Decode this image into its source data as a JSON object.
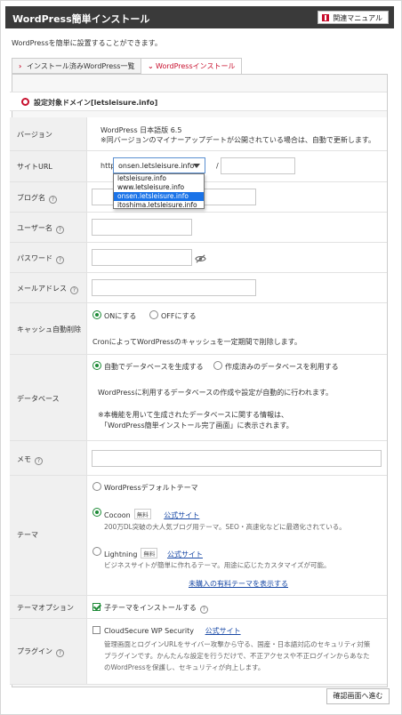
{
  "header": {
    "title": "WordPress簡単インストール",
    "manual_button": "関連マニュアル"
  },
  "intro": "WordPressを簡単に設置することができます。",
  "tabs": [
    {
      "label": "インストール済みWordPress一覧",
      "marker": "›",
      "active": false
    },
    {
      "label": "WordPressインストール",
      "marker": "⌄",
      "active": true
    }
  ],
  "domain": {
    "label": "設定対象ドメイン[letsleisure.info]"
  },
  "fields": {
    "version": {
      "label": "バージョン",
      "line1": "WordPress 日本語版 6.5",
      "line2": "※同バージョンのマイナーアップデートが公開されている場合は、自動で更新します。"
    },
    "site_url": {
      "label": "サイトURL",
      "prefix": "http://",
      "selected": "onsen.letsleisure.info",
      "slash": "/",
      "options": [
        "letsleisure.info",
        "www.letsleisure.info",
        "onsen.letsleisure.info",
        "itoshima.letsleisure.info"
      ],
      "selected_index": 2
    },
    "blog_name": {
      "label": "ブログ名"
    },
    "user_name": {
      "label": "ユーザー名"
    },
    "password": {
      "label": "パスワード"
    },
    "email": {
      "label": "メールアドレス"
    },
    "cache": {
      "label": "キャッシュ自動削除",
      "on_label": "ONにする",
      "off_label": "OFFにする",
      "note": "CronによってWordPressのキャッシュを一定期間で削除します。"
    },
    "database": {
      "label": "データベース",
      "opt_auto": "自動でデータベースを生成する",
      "opt_existing": "作成済みのデータベースを利用する",
      "note1": "WordPressに利用するデータベースの作成や設定が自動的に行われます。",
      "note2": "※本機能を用いて生成されたデータベースに関する情報は、",
      "note3": "「WordPress簡単インストール完了画面」に表示されます。"
    },
    "memo": {
      "label": "メモ"
    },
    "theme": {
      "label": "テーマ",
      "default_theme": "WordPressデフォルトテーマ",
      "cocoon": "Cocoon",
      "cocoon_badge": "無料",
      "cocoon_link": "公式サイト",
      "cocoon_desc": "200万DL突破の大人気ブログ用テーマ。SEO・高速化などに最適化されている。",
      "lightning": "Lightning",
      "lightning_badge": "無料",
      "lightning_link": "公式サイト",
      "lightning_desc": "ビジネスサイトが簡単に作れるテーマ。用途に応じたカスタマイズが可能。",
      "paid_link": "未購入の有料テーマを表示する"
    },
    "theme_option": {
      "label": "テーマオプション",
      "child": "子テーマをインストールする"
    },
    "plugin": {
      "label": "プラグイン",
      "name": "CloudSecure WP Security",
      "link": "公式サイト",
      "desc1": "管理画面とログインURLをサイバー攻撃から守る、国産・日本語対応のセキュリティ対策",
      "desc2": "プラグインです。かんたんな設定を行うだけで、不正アクセスや不正ログインからあなた",
      "desc3": "のWordPressを保護し、セキュリティが向上します。"
    }
  },
  "submit_label": "確認画面へ進む",
  "colors": {
    "accent": "#c8102e",
    "selected_option": "#1a73e8",
    "check": "#1d8a36"
  }
}
